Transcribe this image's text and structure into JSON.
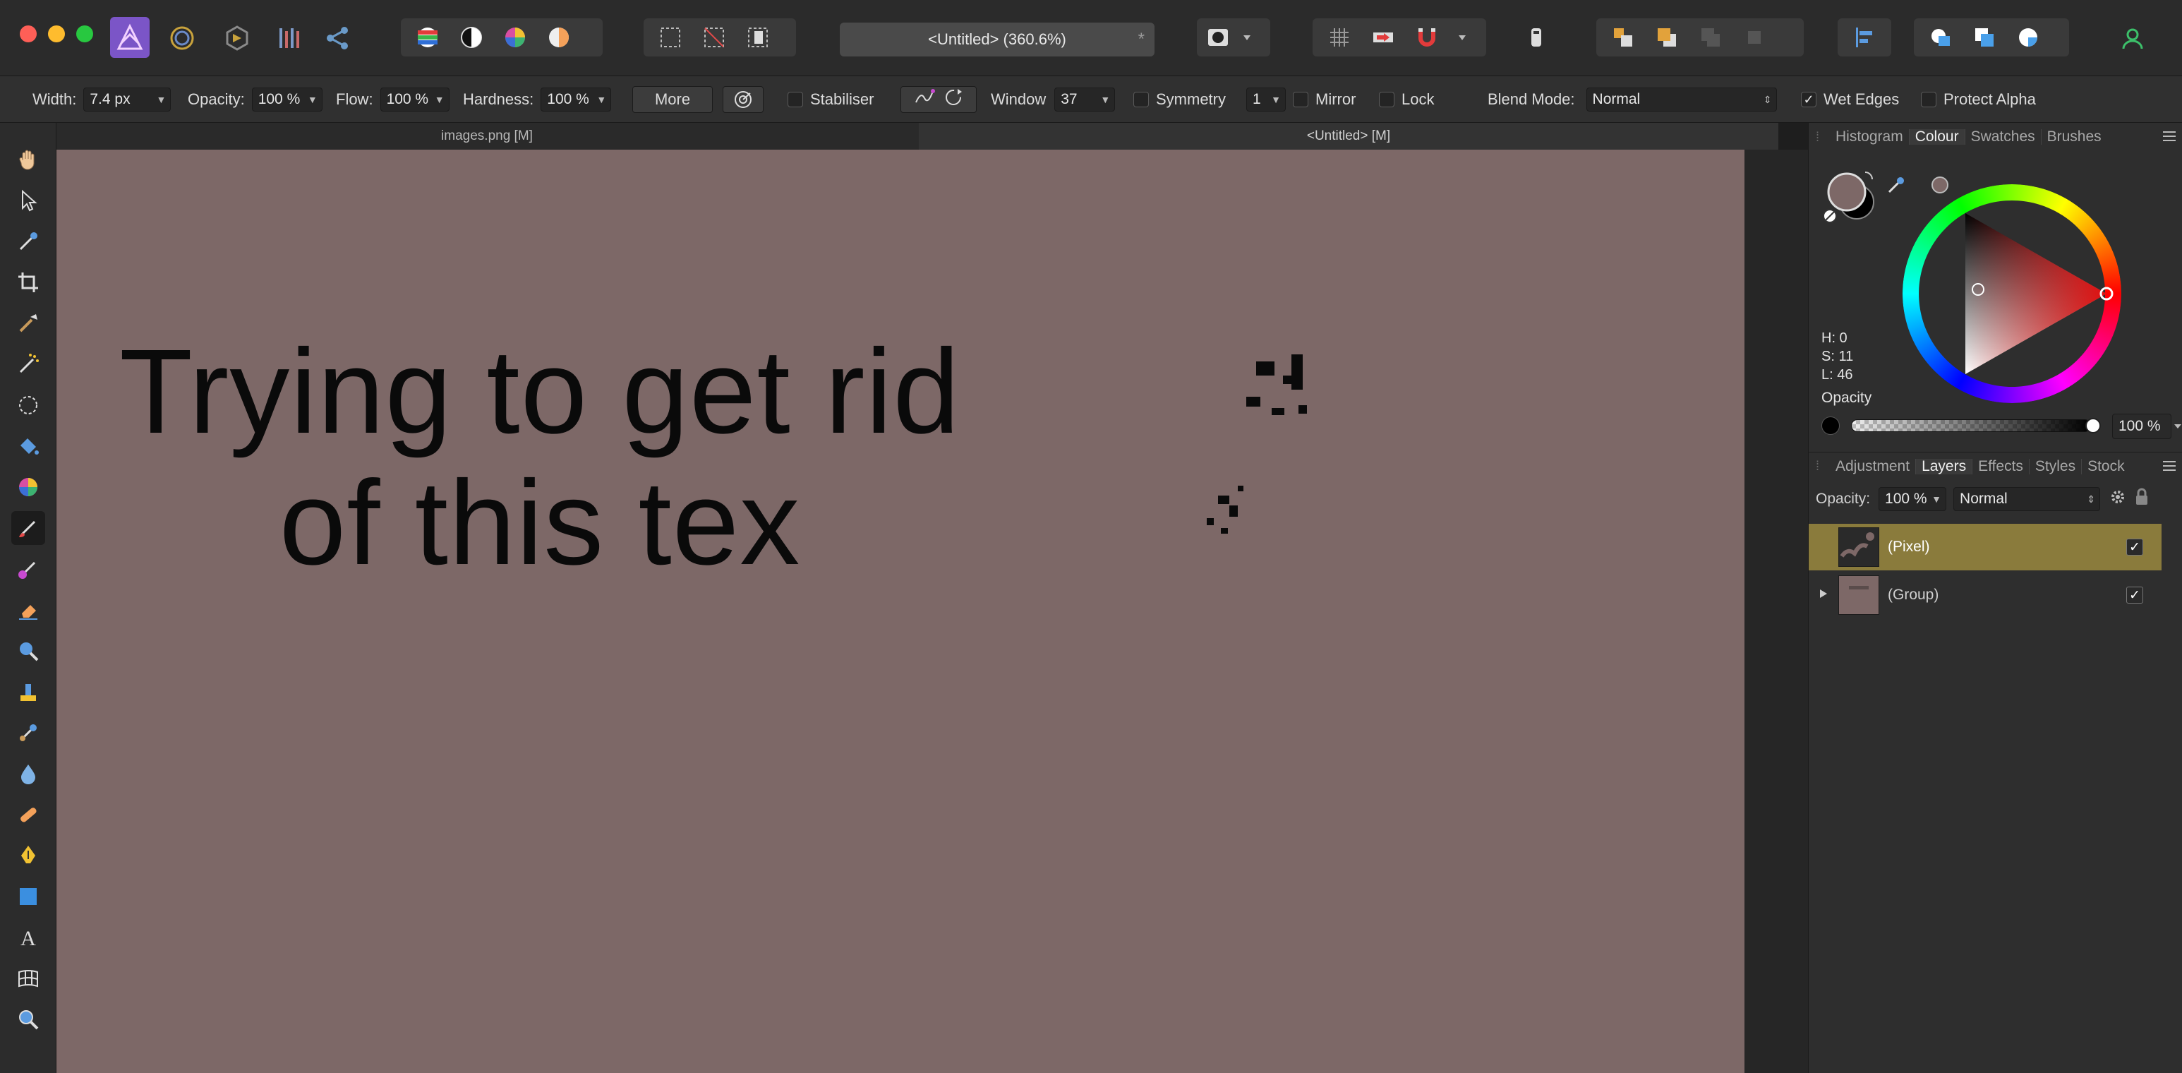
{
  "window": {
    "doc_title": "<Untitled> (360.6%)",
    "doc_modified_mark": "*"
  },
  "context": {
    "width_label": "Width:",
    "width_value": "7.4 px",
    "opacity_label": "Opacity:",
    "opacity_value": "100 %",
    "flow_label": "Flow:",
    "flow_value": "100 %",
    "hardness_label": "Hardness:",
    "hardness_value": "100 %",
    "more_label": "More",
    "stabiliser_label": "Stabiliser",
    "window_label": "Window",
    "window_value": "37",
    "symmetry_label": "Symmetry",
    "symmetry_value": "1",
    "mirror_label": "Mirror",
    "lock_label": "Lock",
    "blend_mode_label": "Blend Mode:",
    "blend_mode_value": "Normal",
    "wet_edges_label": "Wet Edges",
    "wet_edges_checked": true,
    "protect_alpha_label": "Protect Alpha"
  },
  "tabs": [
    {
      "label": "images.png [M]",
      "active": false
    },
    {
      "label": "<Untitled> [M]",
      "active": true
    }
  ],
  "canvas": {
    "line1": "Trying to get rid",
    "line2": "of this tex",
    "background_color": "#7d6867"
  },
  "colour_panel": {
    "tabs": [
      "Histogram",
      "Colour",
      "Swatches",
      "Brushes"
    ],
    "active_tab": "Colour",
    "h": "H: 0",
    "s": "S: 11",
    "l": "L: 46",
    "opacity_label": "Opacity",
    "opacity_value": "100 %",
    "primary_color": "#7d6867"
  },
  "layers_panel": {
    "tabs": [
      "Adjustment",
      "Layers",
      "Effects",
      "Styles",
      "Stock"
    ],
    "active_tab": "Layers",
    "opacity_label": "Opacity:",
    "opacity_value": "100 %",
    "blend_value": "Normal",
    "layers": [
      {
        "name": "(Pixel)",
        "selected": true,
        "expandable": false,
        "visible": true
      },
      {
        "name": "(Group)",
        "selected": false,
        "expandable": true,
        "visible": true
      }
    ]
  }
}
